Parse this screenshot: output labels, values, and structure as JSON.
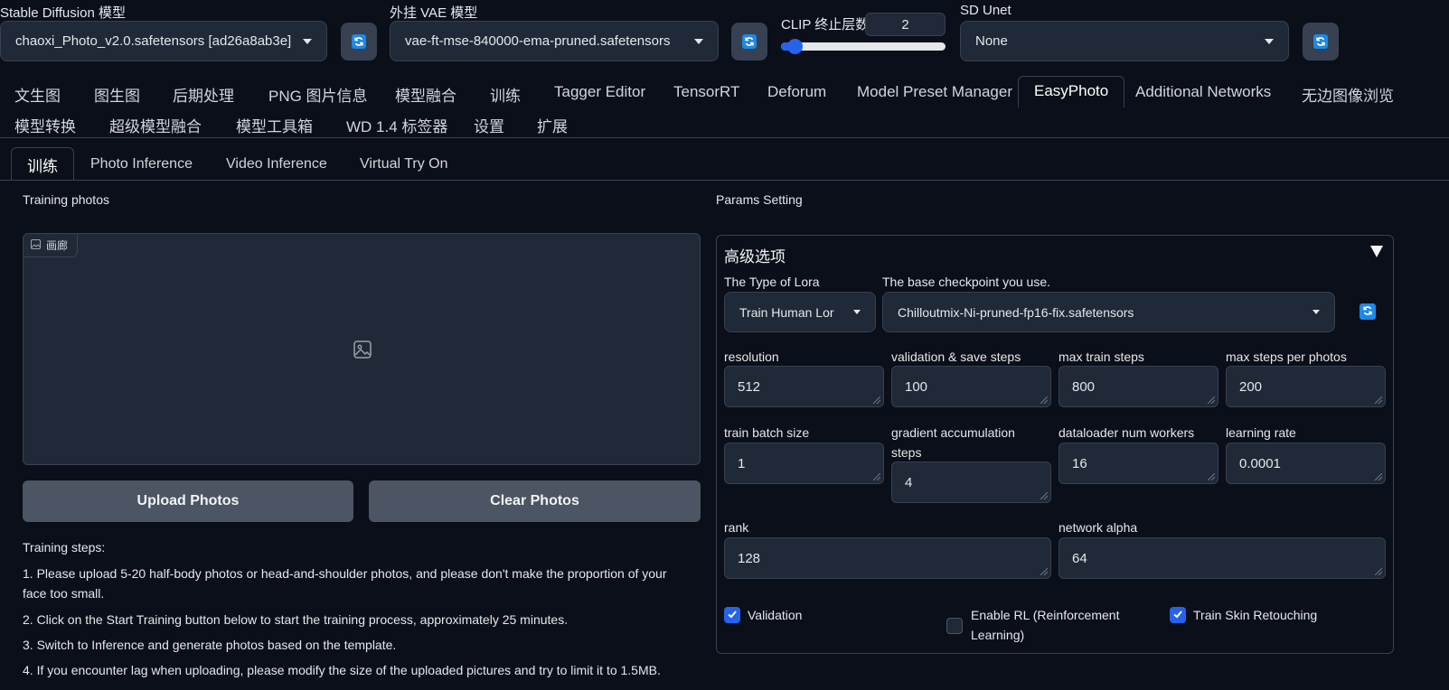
{
  "top": {
    "sd_model_label": "Stable Diffusion 模型",
    "sd_model_value": "chaoxi_Photo_v2.0.safetensors [ad26a8ab3e]",
    "vae_label": "外挂 VAE 模型",
    "vae_value": "vae-ft-mse-840000-ema-pruned.safetensors",
    "clip_label": "CLIP 终止层数",
    "clip_value": "2",
    "clip_slider_fraction": 0.08,
    "unet_label": "SD Unet",
    "unet_value": "None"
  },
  "main_tabs": [
    "文生图",
    "图生图",
    "后期处理",
    "PNG 图片信息",
    "模型融合",
    "训练",
    "Tagger Editor",
    "TensorRT",
    "Deforum",
    "Model Preset Manager",
    "EasyPhoto",
    "Additional Networks",
    "无边图像浏览",
    "模型转换",
    "超级模型融合",
    "模型工具箱",
    "WD 1.4 标签器",
    "设置",
    "扩展"
  ],
  "sub_tabs": [
    "训练",
    "Photo Inference",
    "Video Inference",
    "Virtual Try On"
  ],
  "left": {
    "training_photos_label": "Training photos",
    "gallery_label": "画廊",
    "upload_button": "Upload Photos",
    "clear_button": "Clear Photos",
    "steps_title": "Training steps:",
    "step1a": "1. Please upload 5-20 half-body photos or head-and-shoulder photos, and please don't make the proportion of your",
    "step1b": "face too small.",
    "step2": "2. Click on the Start Training button below to start the training process, approximately 25 minutes.",
    "step3": "3. Switch to Inference and generate photos based on the template.",
    "step4": "4. If you encounter lag when uploading, please modify the size of the uploaded pictures and try to limit it to 1.5MB."
  },
  "right": {
    "params_label": "Params Setting",
    "advanced_title": "高级选项",
    "lora_type_label": "The Type of Lora",
    "lora_type_value": "Train Human Lor",
    "checkpoint_label": "The base checkpoint you use.",
    "checkpoint_value": "Chilloutmix-Ni-pruned-fp16-fix.safetensors",
    "resolution_label": "resolution",
    "resolution_value": "512",
    "valsave_label": "validation & save steps",
    "valsave_value": "100",
    "maxtrain_label": "max train steps",
    "maxtrain_value": "800",
    "maxphoto_label": "max steps per photos",
    "maxphoto_value": "200",
    "batch_label": "train batch size",
    "batch_value": "1",
    "gradacc_label1": "gradient accumulation",
    "gradacc_label2": "steps",
    "gradacc_value": "4",
    "workers_label": "dataloader num workers",
    "workers_value": "16",
    "lr_label": "learning rate",
    "lr_value": "0.0001",
    "rank_label": "rank",
    "rank_value": "128",
    "alpha_label": "network alpha",
    "alpha_value": "64",
    "validation_label": "Validation",
    "rl_label1": "Enable RL (Reinforcement",
    "rl_label2": "Learning)",
    "skin_label": "Train Skin Retouching"
  },
  "colors": {
    "accent": "#2563eb",
    "refresh_icon": "#1e88e5",
    "bg": "#0b0f19",
    "field": "#1f2937"
  }
}
